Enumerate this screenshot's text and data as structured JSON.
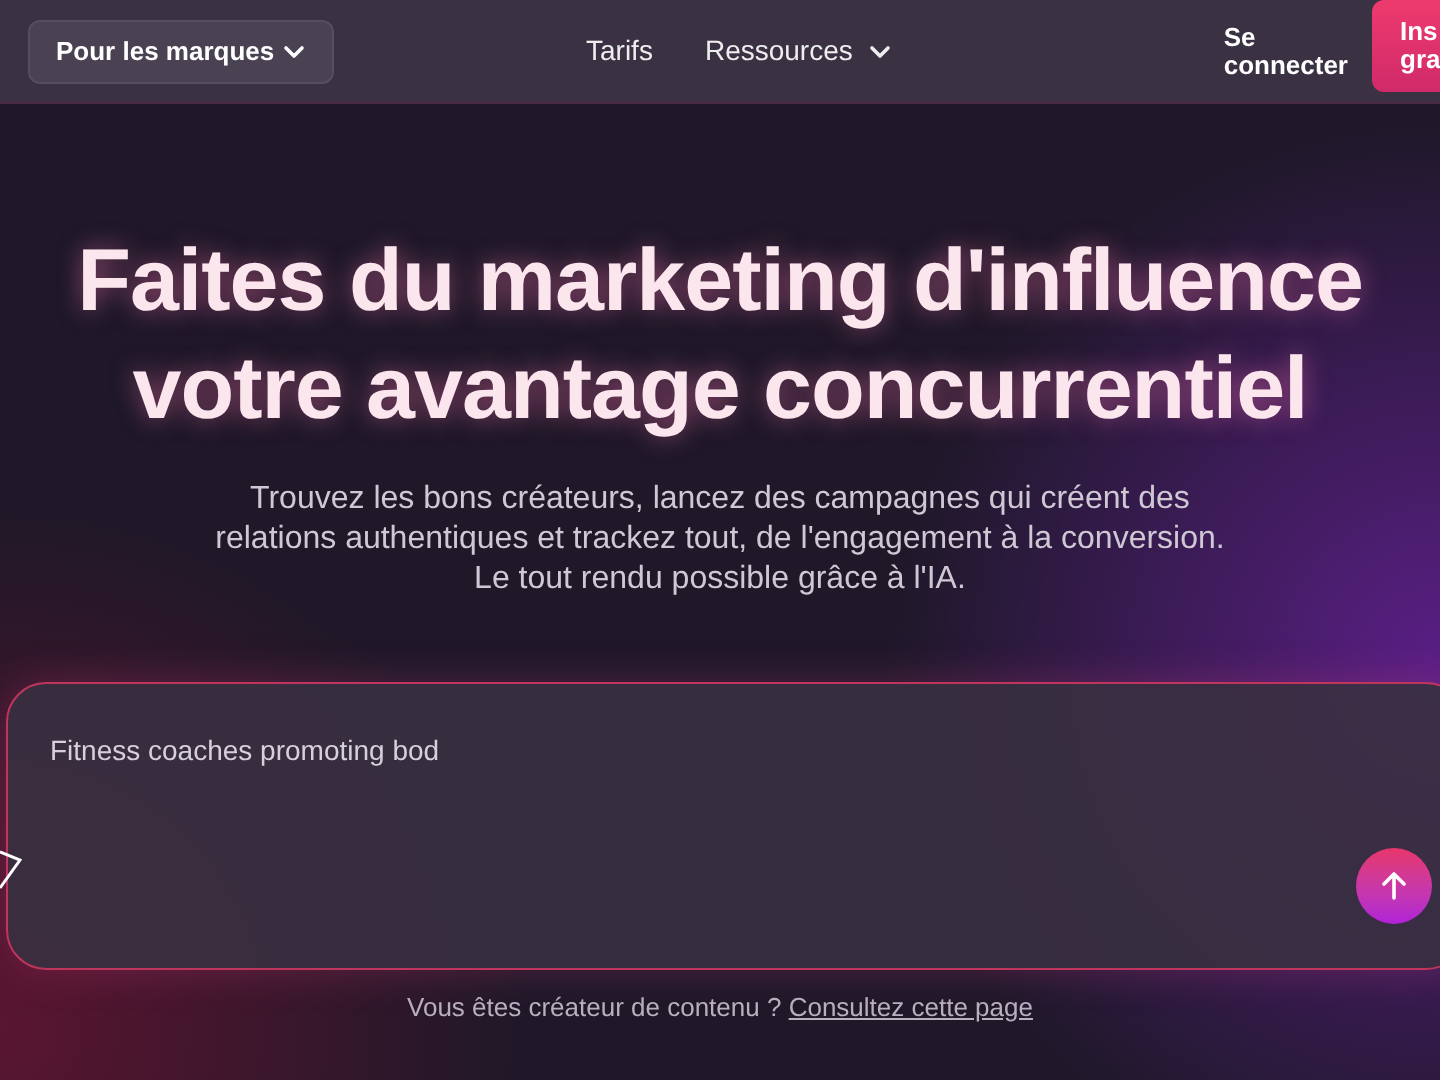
{
  "nav": {
    "brand_menu": "Pour les marques",
    "links": [
      {
        "label": "Tarifs",
        "kind": "link"
      },
      {
        "label": "Ressources",
        "kind": "dropdown"
      }
    ],
    "login": [
      "Se",
      "connecter"
    ],
    "signup": [
      "Ins",
      "gra"
    ]
  },
  "hero": {
    "title": [
      "Faites du marketing d'influence",
      "votre avantage concurrentiel"
    ],
    "subtitle": [
      "Trouvez les bons créateurs, lancez des campagnes qui créent des",
      "relations authentiques et trackez tout, de l'engagement à la conversion.",
      "Le tout rendu possible grâce à l'IA."
    ]
  },
  "prompt": {
    "value": "Fitness coaches promoting bod"
  },
  "footer": {
    "text": "Vous êtes créateur de contenu ?",
    "link": "Consultez cette page"
  }
}
